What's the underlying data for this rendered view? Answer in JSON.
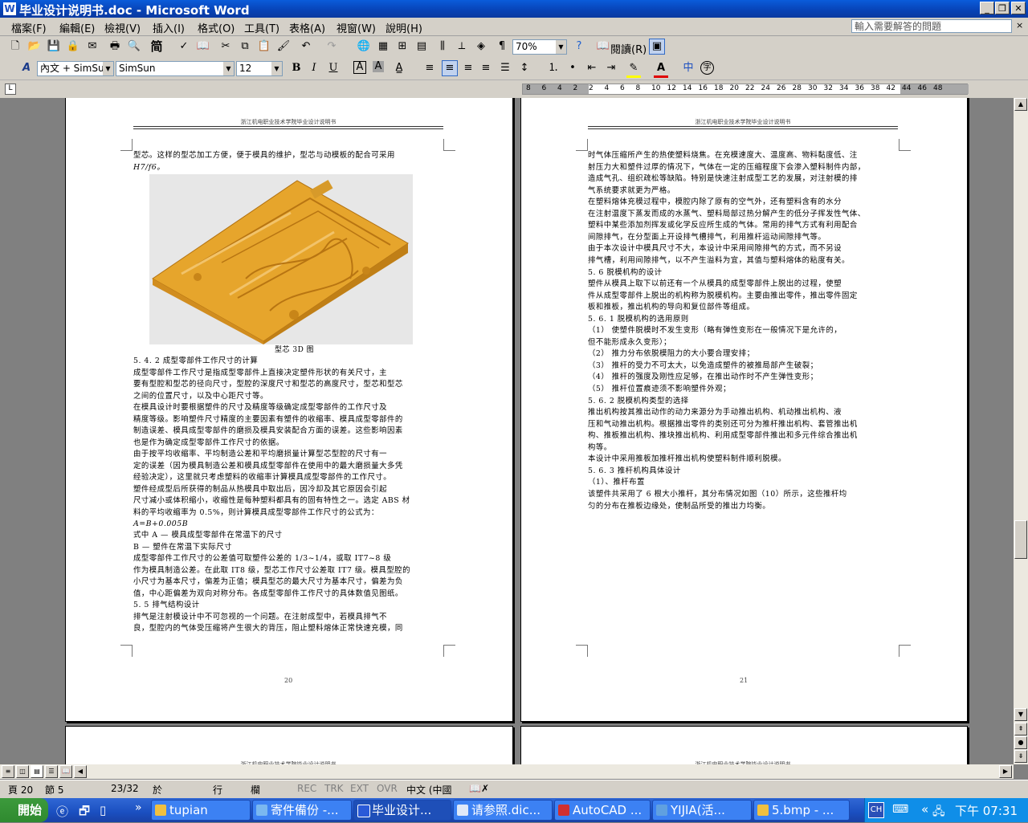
{
  "window": {
    "title": "毕业设计说明书.doc - Microsoft Word",
    "help_search_placeholder": "輸入需要解答的問題"
  },
  "menu": [
    "檔案(F)",
    "編輯(E)",
    "檢視(V)",
    "插入(I)",
    "格式(O)",
    "工具(T)",
    "表格(A)",
    "視窗(W)",
    "說明(H)"
  ],
  "toolbar": {
    "zoom": "70%",
    "read_label": "閱讀(R)",
    "style": "內文 + SimSun",
    "font": "SimSun",
    "font_size": "12"
  },
  "ruler": {
    "left_ticks": [
      "8",
      "6",
      "4",
      "2"
    ],
    "right_ticks": [
      "2",
      "4",
      "6",
      "8",
      "10",
      "12",
      "14",
      "16",
      "18",
      "20",
      "22",
      "24",
      "26",
      "28",
      "30",
      "32",
      "34",
      "36",
      "38",
      "42",
      "44",
      "46",
      "48"
    ]
  },
  "pages": {
    "header_text": "浙江机电职业技术学院毕业设计说明书",
    "left_page_number": "20",
    "right_page_number": "21",
    "figure_caption": "型芯 3D 图",
    "left_lines": [
      "型芯。这样的型芯加工方便，便于模具的维护，型芯与动模板的配合可采用",
      "H7/f6。",
      "5. 4. 2  成型零部件工作尺寸的计算",
      "    成型零部件工作尺寸是指成型零部件上直接决定塑件形状的有关尺寸，主",
      "要有型腔和型芯的径向尺寸，型腔的深度尺寸和型芯的高度尺寸，型芯和型芯",
      "之间的位置尺寸，以及中心距尺寸等。",
      "    在模具设计时要根据塑件的尺寸及精度等级确定成型零部件的工作尺寸及",
      "精度等级。影响塑件尺寸精度的主要因素有塑件的收缩率、模具成型零部件的",
      "制造误差、模具成型零部件的磨损及模具安装配合方面的误差。这些影响因素",
      "也是作为确定成型零部件工作尺寸的依据。",
      "    由于按平均收缩率、平均制造公差和平均磨损量计算型芯型腔的尺寸有一",
      "定的误差（因为模具制造公差和模具成型零部件在使用中的最大磨损量大多凭",
      "经验决定），这里就只考虑塑料的收缩率计算模具成型零部件的工作尺寸。",
      "    塑件经成型后所获得的制品从热模具中取出后，因冷却及其它原因会引起",
      "尺寸减小或体积缩小，收缩性是每种塑料都具有的固有特性之一。选定 ABS 材",
      "料的平均收缩率为 0.5%，则计算模具成型零部件工作尺寸的公式为：",
      "                          A=B+0.005B",
      "    式中            A — 模具成型零部件在常温下的尺寸",
      "                    B — 塑件在常温下实际尺寸",
      "    成型零部件工作尺寸的公差值可取塑件公差的 1/3~1/4，或取 IT7~8 级",
      "作为模具制造公差。在此取 IT8 级，型芯工作尺寸公差取 IT7 级。模具型腔的",
      "小尺寸为基本尺寸，偏差为正值；模具型芯的最大尺寸为基本尺寸，偏差为负",
      "值，中心距偏差为双向对称分布。各成型零部件工作尺寸的具体数值见图纸。",
      "5. 5  排气结构设计",
      "    排气是注射模设计中不可忽视的一个问题。在注射成型中，若模具排气不",
      "良，型腔内的气体受压缩将产生很大的背压，阻止塑料熔体正常快速充模，同"
    ],
    "right_lines": [
      "时气体压缩所产生的热使塑料烧焦。在充模速度大、温度高、物料黏度低、注",
      "射压力大和塑件过厚的情况下，气体在一定的压缩程度下会渗入塑料制件内部，",
      "造成气孔、组织疏松等缺陷。特别是快速注射成型工艺的发展，对注射模的排",
      "气系统要求就更为严格。",
      "    在塑料熔体充模过程中，模腔内除了原有的空气外，还有塑料含有的水分",
      "在注射温度下蒸发而成的水蒸气、塑料局部过热分解产生的低分子挥发性气体、",
      "塑料中某些添加剂挥发或化学反应所生成的气体。常用的排气方式有利用配合",
      "间隙排气，在分型面上开设排气槽排气，利用推杆运动间隙排气等。",
      "    由于本次设计中模具尺寸不大，本设计中采用间隙排气的方式，而不另设",
      "排气槽，利用间隙排气，以不产生溢料为宜，其值与塑料熔体的粘度有关。",
      "5. 6  脱模机构的设计",
      "    塑件从模具上取下以前还有一个从模具的成型零部件上脱出的过程，使塑",
      "件从成型零部件上脱出的机构称为脱模机构。主要由推出零件，推出零件固定",
      "板和推板，推出机构的导向和复位部件等组成。",
      "5. 6. 1  脱模机构的选用原则",
      "    （1）  使塑件脱模时不发生变形（略有弹性变形在一般情况下是允许的，",
      "           但不能形成永久变形）；",
      "    （2）  推力分布依脱模阻力的大小要合理安排；",
      "    （3）  推杆的受力不可太大，以免造成塑件的被推局部产生破裂；",
      "    （4）  推杆的强度及刚性应足够，在推出动作时不产生弹性变形；",
      "    （5）  推杆位置痕迹须不影响塑件外观；",
      "5. 6. 2  脱模机构类型的选择",
      "    推出机构按其推出动作的动力来源分为手动推出机构、机动推出机构、液",
      "压和气动推出机构。根据推出零件的类别还可分为推杆推出机构、套管推出机",
      "构、推板推出机构、推块推出机构、利用成型零部件推出和多元件综合推出机",
      "构等。",
      "    本设计中采用推板加推杆推出机构使塑料制件顺利脱模。",
      "5. 6. 3  推杆机构具体设计",
      "（1）、推杆布置",
      "    该塑件共采用了 6 根大小推杆，其分布情况如图（10）所示，这些推杆均",
      "匀的分布在推板边缘处，使制品所受的推出力均衡。"
    ]
  },
  "status": {
    "page": "頁 20",
    "section": "節 5",
    "count": "23/32",
    "at": "於",
    "line": "行",
    "col": "欄",
    "rec": "REC",
    "trk": "TRK",
    "ext": "EXT",
    "ovr": "OVR",
    "lang": "中文 (中國"
  },
  "taskbar": {
    "start": "開始",
    "tasks": [
      "tupian",
      "寄件備份 -...",
      "毕业设计...",
      "请参照.dic...",
      "AutoCAD ...",
      "YIJIA(活...",
      "5.bmp - ..."
    ],
    "ime": "CH",
    "clock": "下午 07:31"
  },
  "colors": {
    "title_bar": "#0a5cda",
    "model_orange": "#e8a52a"
  }
}
